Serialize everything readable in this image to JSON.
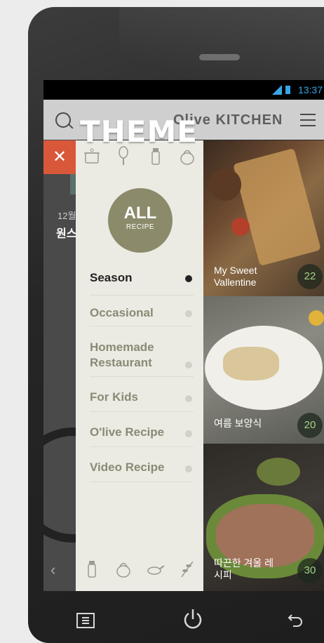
{
  "status_bar": {
    "time": "13:37"
  },
  "app_bar": {
    "title": "Olive KITCHEN"
  },
  "background": {
    "date_text": "12월",
    "title_text": "원스"
  },
  "drawer": {
    "heading": "THEME",
    "all_button": {
      "main": "ALL",
      "sub": "RECIPE"
    },
    "menu": [
      {
        "label": "Season",
        "active": true
      },
      {
        "label": "Occasional",
        "active": false
      },
      {
        "label": "Homemade Restaurant",
        "active": false
      },
      {
        "label": "For Kids",
        "active": false
      },
      {
        "label": "O'live Recipe",
        "active": false
      },
      {
        "label": "Video Recipe",
        "active": false
      }
    ],
    "top_icons": [
      "pot-icon",
      "whisk-icon",
      "salt-shaker-icon",
      "kettle-icon"
    ],
    "bottom_icons": [
      "salt-shaker-icon",
      "kettle-icon",
      "frying-pan-icon",
      "herb-icon"
    ]
  },
  "recipes": [
    {
      "caption": "My Sweet Vallentine",
      "count": "22"
    },
    {
      "caption": "여름 보양식",
      "count": "20"
    },
    {
      "caption": "따끈한 겨울 레시피",
      "count": "30"
    }
  ],
  "colors": {
    "close_button": "#d9583a",
    "all_badge": "#8b8b6b",
    "drawer_bg": "#ecebe3",
    "status_time": "#37a6e6",
    "count_text": "#a6d28a"
  }
}
